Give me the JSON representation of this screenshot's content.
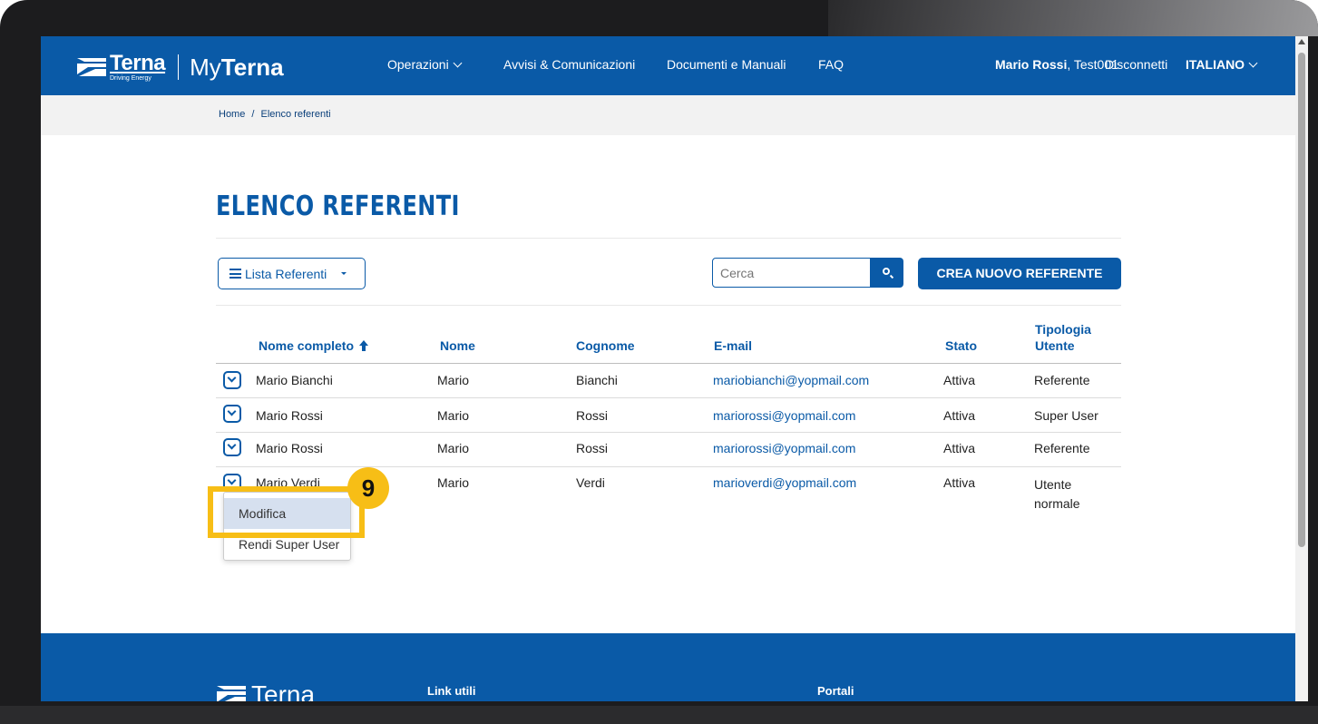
{
  "brand": {
    "logo_word": "Terna",
    "logo_tagline": "Driving Energy",
    "my_prefix": "My",
    "my_suffix": "Terna"
  },
  "nav": {
    "items": [
      "Operazioni",
      "Avvisi & Comunicazioni",
      "Documenti e Manuali",
      "FAQ"
    ]
  },
  "user": {
    "name": "Mario Rossi",
    "account": ", Test001",
    "logout": "Disconnetti",
    "language": "ITALIANO"
  },
  "breadcrumb": {
    "home": "Home",
    "separator": "/",
    "current": "Elenco referenti"
  },
  "page": {
    "title": "ELENCO REFERENTI"
  },
  "controls": {
    "list_button": "Lista Referenti",
    "search_placeholder": "Cerca",
    "create_button": "CREA NUOVO REFERENTE"
  },
  "table": {
    "headers": {
      "full_name": "Nome completo",
      "first_name": "Nome",
      "last_name": "Cognome",
      "email": "E-mail",
      "status": "Stato",
      "user_type_1": "Tipologia",
      "user_type_2": "Utente"
    },
    "rows": [
      {
        "full_name": "Mario Bianchi",
        "first_name": "Mario",
        "last_name": "Bianchi",
        "email": "mariobianchi@yopmail.com",
        "status": "Attiva",
        "type_1": "Referente",
        "type_2": ""
      },
      {
        "full_name": "Mario Rossi",
        "first_name": "Mario",
        "last_name": "Rossi",
        "email": "mariorossi@yopmail.com",
        "status": "Attiva",
        "type_1": "Super User",
        "type_2": ""
      },
      {
        "full_name": "Mario Rossi",
        "first_name": "Mario",
        "last_name": "Rossi",
        "email": "mariorossi@yopmail.com",
        "status": "Attiva",
        "type_1": "Referente",
        "type_2": ""
      },
      {
        "full_name": "Mario Verdi",
        "first_name": "Mario",
        "last_name": "Verdi",
        "email": "marioverdi@yopmail.com",
        "status": "Attiva",
        "type_1": "Utente",
        "type_2": "normale"
      }
    ]
  },
  "row_menu": {
    "items": [
      "Modifica",
      "Rendi Super User"
    ]
  },
  "annotation": {
    "step": "9",
    "color": "#f7be16"
  },
  "footer": {
    "logo_word": "Terna",
    "col1_title": "Link utili",
    "col2_title": "Portali"
  },
  "colors": {
    "primary": "#0a5aa7",
    "breadcrumb_bg": "#f2f2f2",
    "highlight": "#f7be16"
  }
}
